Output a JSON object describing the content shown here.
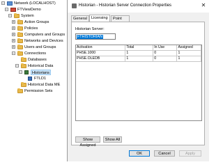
{
  "tree": {
    "items": [
      {
        "label": "Network (LOCALHOST)",
        "icon": "network-icon"
      },
      {
        "label": "FTViewDemo",
        "icon": "application-icon"
      },
      {
        "label": "System",
        "icon": "folder-icon"
      },
      {
        "label": "Action Groups",
        "icon": "folder-icon"
      },
      {
        "label": "Policies",
        "icon": "folder-icon"
      },
      {
        "label": "Computers and Groups",
        "icon": "folder-icon"
      },
      {
        "label": "Networks and Devices",
        "icon": "folder-icon"
      },
      {
        "label": "Users and Groups",
        "icon": "folder-icon"
      },
      {
        "label": "Connections",
        "icon": "folder-icon"
      },
      {
        "label": "Databases",
        "icon": "folder-icon"
      },
      {
        "label": "Historical Data",
        "icon": "folder-icon"
      },
      {
        "label": "Historians",
        "icon": "historian-icon"
      },
      {
        "label": "FTLD1",
        "icon": "historian-server-icon"
      },
      {
        "label": "Historical Data ME",
        "icon": "folder-icon"
      },
      {
        "label": "Permission Sets",
        "icon": "folder-icon"
      }
    ]
  },
  "dialog": {
    "title": "Historian - Historian Server Connection Properties",
    "close_glyph": "✕",
    "tabs": [
      {
        "label": "General"
      },
      {
        "label": "Licensing"
      },
      {
        "label": "Point Sources"
      }
    ],
    "server_label": "Historian Server:",
    "server_value": "FTHISTORIAN",
    "table": {
      "headers": [
        "Activation",
        "Total",
        "In Use",
        "Assigned"
      ],
      "rows": [
        [
          "PHSE.1000",
          "1",
          "0",
          "1"
        ],
        [
          "PHSE.OLEDB",
          "1",
          "0",
          "1"
        ]
      ]
    },
    "buttons": {
      "show_assigned": "Show Assigned",
      "show_all": "Show All",
      "ok": "OK",
      "cancel": "Cancel",
      "apply": "Apply"
    }
  },
  "colors": {
    "selection": "#0078d7",
    "folder": "#e8b94a",
    "dialog_bg": "#f0f0f0"
  }
}
